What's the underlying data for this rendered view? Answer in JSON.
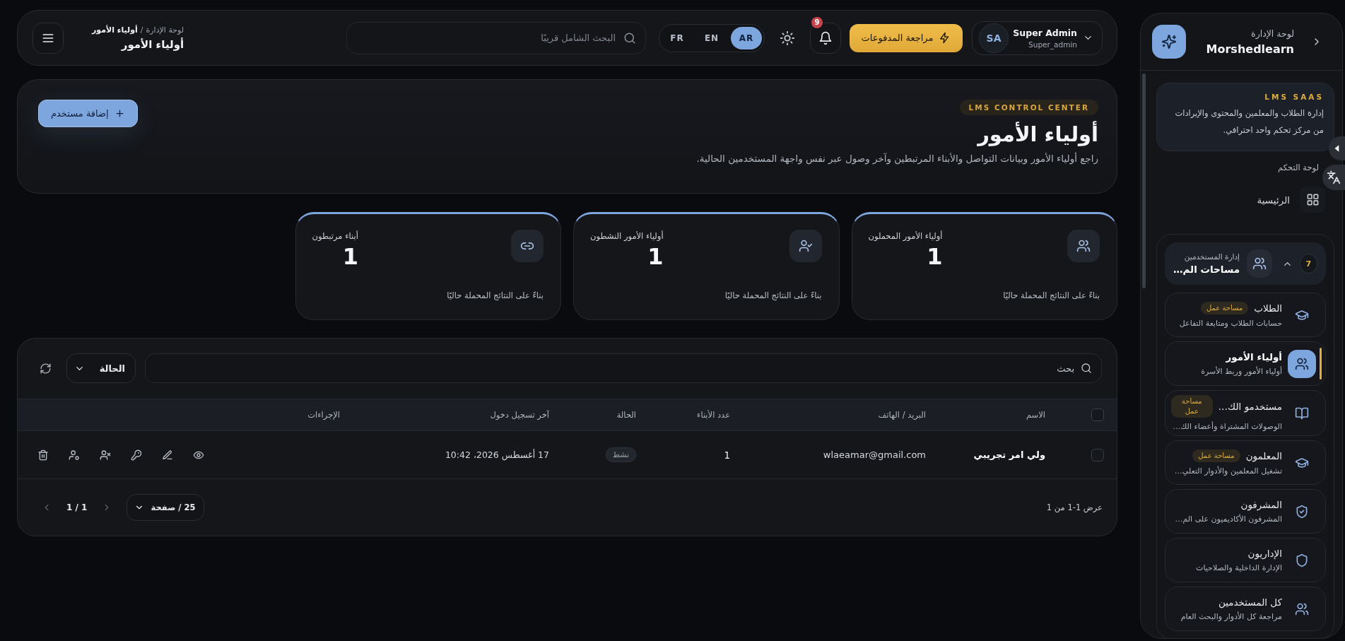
{
  "header": {
    "breadcrumb": [
      {
        "label": "لوحة الإدارة",
        "current": false
      },
      {
        "label": "أولياء الأمور",
        "current": true
      }
    ],
    "breadcrumb_separator": "/",
    "title": "أولياء الأمور",
    "search": {
      "placeholder": "البحث الشامل قريبًا"
    },
    "languages": [
      {
        "label": "AR",
        "selected": true
      },
      {
        "label": "EN",
        "selected": false
      },
      {
        "label": "FR",
        "selected": false
      }
    ],
    "notifications": {
      "count": "9"
    },
    "payments_button": "مراجعة المدفوعات",
    "user": {
      "initials": "SA",
      "name": "Super Admin",
      "username": "Super_admin"
    }
  },
  "hero": {
    "eyebrow": "LMS CONTROL CENTER",
    "title": "أولياء الأمور",
    "description": "راجع أولياء الأمور وبيانات التواصل والأبناء المرتبطين وآخر وصول عبر نفس واجهة المستخدمين الحالية.",
    "add_button": "إضافة مستخدم"
  },
  "stats": [
    {
      "kind": "total",
      "label": "أولياء الأمور المحملون",
      "value": "1",
      "note": "بناءً على النتائج المحملة حاليًا"
    },
    {
      "kind": "active",
      "label": "أولياء الأمور النشطون",
      "value": "1",
      "note": "بناءً على النتائج المحملة حاليًا"
    },
    {
      "kind": "linked",
      "label": "أبناء مرتبطون",
      "value": "1",
      "note": "بناءً على النتائج المحملة حاليًا"
    }
  ],
  "table": {
    "search": {
      "placeholder": "بحث"
    },
    "status_filter": "الحالة",
    "select_all": {
      "checked": false
    },
    "columns": [
      "الاسم",
      "البريد / الهاتف",
      "عدد الأبناء",
      "الحالة",
      "آخر تسجيل دخول",
      "الإجراءات"
    ],
    "rows": [
      {
        "selected": false,
        "name": "ولي امر تجريبي",
        "contact": "wlaeamar@gmail.com",
        "children": "1",
        "status": "نشط",
        "last_login": "17 أغسطس 2026، 10:42"
      }
    ],
    "footer": {
      "summary": "عرض 1-1 من 1",
      "page_size": "25 / صفحة",
      "page": "1 / 1",
      "previous": {
        "disabled": true
      },
      "next": {
        "disabled": true
      }
    }
  },
  "sidebar": {
    "brand": {
      "subtitle": "لوحة الإدارة",
      "name": "Morshedlearn"
    },
    "promo": {
      "eyebrow": "LMS SAAS",
      "text": "إدارة الطلاب والمعلمين والمحتوى والإيرادات من مركز تحكم واحد احترافي."
    },
    "section_label": "لوحة التحكم",
    "home": {
      "label": "الرئيسية",
      "selected": false
    },
    "group": {
      "label": "إدارة المستخدمين",
      "title": "مساحات الم…",
      "count": "7",
      "expanded": true,
      "items": [
        {
          "kind": "students",
          "title": "الطلاب",
          "badge": "مساحة عمل",
          "description": "حسابات الطلاب ومتابعة التفاعل",
          "selected": false
        },
        {
          "kind": "guardians",
          "title": "أولياء الأمور",
          "description": "أولياء الأمور وربط الأسرة",
          "selected": true
        },
        {
          "kind": "subscribers",
          "title": "مستخدمو الك…",
          "badge": "مساحة عمل",
          "description": "الوصولات المشتراة وأعضاء الك…",
          "selected": false
        },
        {
          "kind": "teachers",
          "title": "المعلمون",
          "badge": "مساحة عمل",
          "description": "تشغيل المعلمين والأدوار التعلي…",
          "selected": false
        },
        {
          "kind": "supervisors",
          "title": "المشرفون",
          "description": "المشرفون الأكاديميون على الم…",
          "selected": false
        },
        {
          "kind": "admins",
          "title": "الإداريون",
          "description": "الإدارة الداخلية والصلاحيات",
          "selected": false
        },
        {
          "kind": "everyone",
          "title": "كل المستخدمين",
          "description": "مراجعة كل الأدوار والبحث العام",
          "selected": false
        }
      ]
    }
  }
}
